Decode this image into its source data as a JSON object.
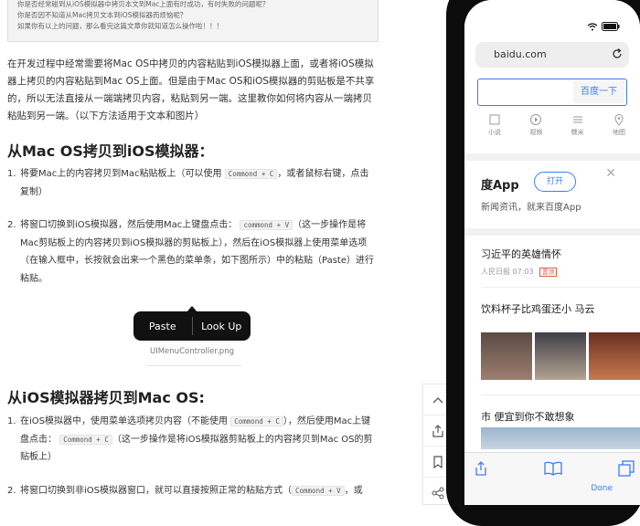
{
  "quote": {
    "line1": "你是否经常碰到从iOS模拟器中拷贝本文到Mac上面有时成功，有时失败的问题呢？",
    "line2": "你是否因不知道从Mac拷贝文本到iOS模拟器而烦恼呢？",
    "line3": "如果你有以上的问题，那么看完这篇文章你就知道怎么操作啦！！！"
  },
  "intro": "在开发过程中经常需要将Mac OS中拷贝的内容粘贴到iOS模拟器上面，或者将iOS模拟器上拷贝的内容粘贴到Mac OS上面。但是由于Mac OS和iOS模拟器的剪贴板是不共享的，所以无法直接从一端端拷贝内容，粘贴到另一端。这里教你如何将内容从一端拷贝粘贴到另一端。（以下方法适用于文本和图片）",
  "section1": {
    "title": "从Mac OS拷贝到iOS模拟器：",
    "item1_num": "1.",
    "item1_a": "将要Mac上的内容拷贝到Mac粘贴板上（可以使用",
    "item1_code": "Commond + C",
    "item1_b": "，或者鼠标右键，点击复制）",
    "item2_num": "2.",
    "item2_a": "将窗口切换到iOS模拟器，然后使用Mac上键盘点击：",
    "item2_code": "commond + V",
    "item2_b": "（这一步操作是将Mac剪贴板上的内容拷贝到iOS模拟器的剪贴板上），然后在iOS模拟器上使用菜单选项（在输入框中，长按就会出来一个黑色的菜单条，如下图所示）中的粘贴（Paste）进行粘贴。"
  },
  "menu_image": {
    "paste": "Paste",
    "lookup": "Look Up",
    "caption": "UIMenuController.png"
  },
  "section2": {
    "title": "从iOS模拟器拷贝到Mac OS:",
    "item1_num": "1.",
    "item1_a": "在iOS模拟器中，使用菜单选项拷贝内容（不能使用",
    "item1_code1": "Commond + C",
    "item1_b": "），然后使用Mac上键盘点击：",
    "item1_code2": "Commond + C",
    "item1_c": "（这一步操作是将iOS模拟器剪贴板上的内容拷贝到Mac OS的剪贴板上）",
    "item2_num": "2.",
    "item2_a": "将窗口切换到非iOS模拟器窗口，就可以直接按照正常的粘贴方式（",
    "item2_code": "Commond + V",
    "item2_b": "，或"
  },
  "side_tools": [
    "chevron-up-icon",
    "share-icon",
    "bookmark-icon",
    "share-nodes-icon"
  ],
  "phone": {
    "url": "baidu.com",
    "search_button": "百度一下",
    "quick": [
      "小说",
      "视频",
      "糯米",
      "地图"
    ],
    "app_title": "度App",
    "app_open": "打开",
    "app_sub": "新闻资讯，就来百度App",
    "app_close": "✕",
    "news1": "习近平的英雄情怀",
    "news1_source": "人民日报",
    "news1_time": "07:03",
    "news1_tag": "置顶",
    "news2": "饮料杯子比鸡蛋还小 马云",
    "news3": "市 便宜到你不敢想象",
    "done": "Done"
  },
  "colors": {
    "accent": "#3d7cf4",
    "code_bg": "#f2f2f2"
  }
}
